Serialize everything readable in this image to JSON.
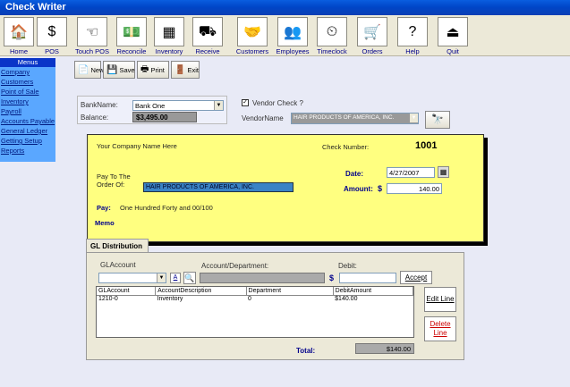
{
  "window": {
    "title": "Check Writer"
  },
  "toolbar": [
    {
      "label": "Home",
      "icon": "house-icon",
      "glyph": "🏠"
    },
    {
      "label": "POS",
      "icon": "dollar-icon",
      "glyph": "$"
    },
    {
      "label": "Touch POS",
      "icon": "hand-icon",
      "glyph": "☜"
    },
    {
      "label": "Reconcile",
      "icon": "money-icon",
      "glyph": "💵"
    },
    {
      "label": "Inventory",
      "icon": "box-icon",
      "glyph": "▦"
    },
    {
      "label": "Receive",
      "icon": "truck-icon",
      "glyph": "⛟"
    },
    {
      "label": "Customers",
      "icon": "handshake-icon",
      "glyph": "🤝"
    },
    {
      "label": "Employees",
      "icon": "people-icon",
      "glyph": "👥"
    },
    {
      "label": "Timeclock",
      "icon": "clock-icon",
      "glyph": "⏲"
    },
    {
      "label": "Orders",
      "icon": "cart-icon",
      "glyph": "🛒"
    },
    {
      "label": "Help",
      "icon": "help-icon",
      "glyph": "?"
    },
    {
      "label": "Quit",
      "icon": "exit-icon",
      "glyph": "⏏"
    }
  ],
  "sidebar": {
    "header": "Menus",
    "items": [
      "Company",
      "Customers",
      "Point of Sale",
      "Inventory",
      "Payroll",
      "Accounts Payable",
      "General Ledger",
      "Getting Setup",
      "Reports"
    ]
  },
  "actions": {
    "new": "New",
    "save": "Save",
    "print": "Print",
    "exit": "Exit"
  },
  "bank": {
    "name_label": "BankName:",
    "name_value": "Bank One",
    "balance_label": "Balance:",
    "balance_value": "$3,495.00"
  },
  "vendor": {
    "check_label": "Vendor Check ?",
    "name_label": "VendorName",
    "name_value": "HAIR PRODUCTS OF AMERICA, INC."
  },
  "check": {
    "company": "Your Company Name Here",
    "number_label": "Check Number:",
    "number_value": "1001",
    "payto_label_1": "Pay To The",
    "payto_label_2": "Order Of:",
    "payto_value": "HAIR PRODUCTS OF AMERICA, INC.",
    "date_label": "Date:",
    "date_value": "4/27/2007",
    "amount_label": "Amount:",
    "currency": "$",
    "amount_value": "140.00",
    "pay_label": "Pay:",
    "pay_words": "One Hundred Forty and 00/100",
    "memo_label": "Memo"
  },
  "gl": {
    "tab": "GL Distribution",
    "account_label": "GLAccount",
    "dept_label": "Account/Department:",
    "debit_label": "Debit:",
    "currency": "$",
    "accept": "Accept",
    "a_btn": "A",
    "edit": "Edit Line",
    "delete_1": "Delete",
    "delete_2": "Line",
    "total_label": "Total:",
    "total_value": "$140.00",
    "columns": [
      "GLAccount",
      "AccountDescription",
      "Department",
      "DebitAmount"
    ],
    "rows": [
      [
        "1210-0",
        "Inventory",
        "0",
        "$140.00"
      ]
    ]
  }
}
